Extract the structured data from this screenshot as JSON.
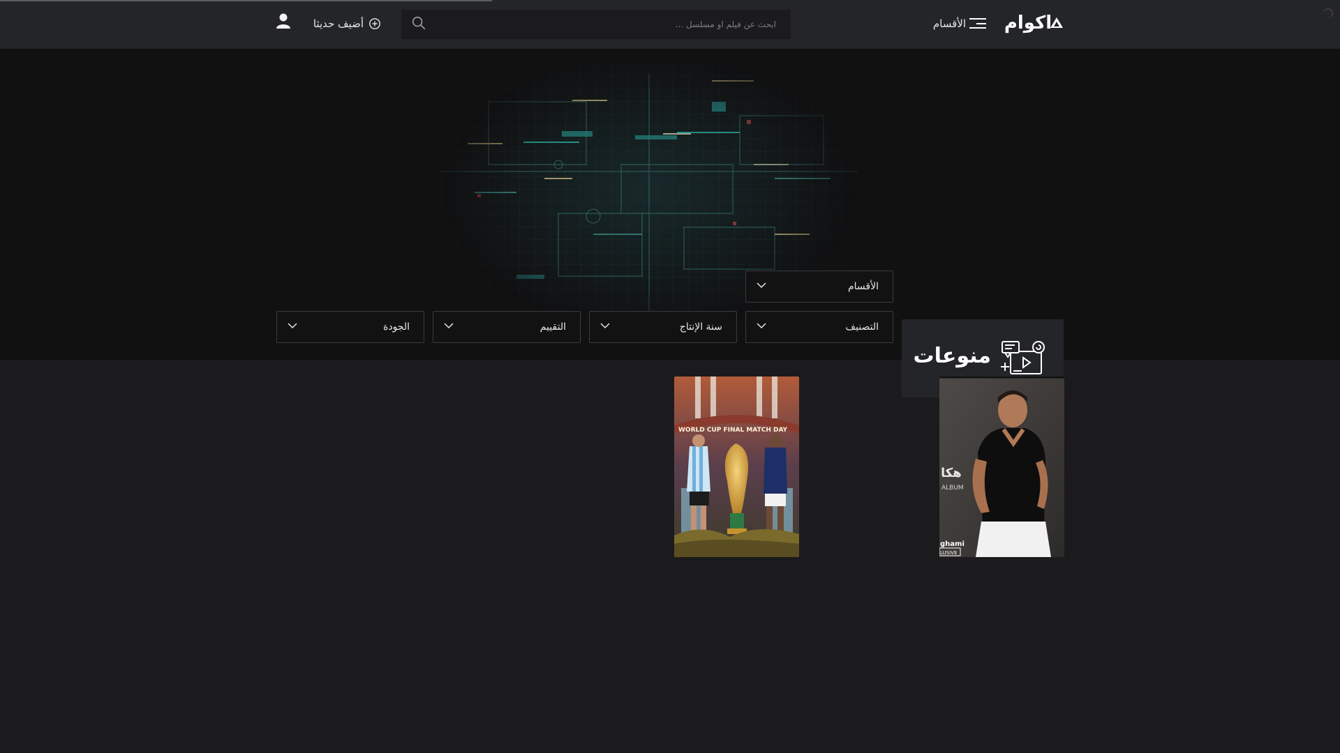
{
  "header": {
    "logo_text": "اكوام",
    "categories_label": "الأقسام",
    "search_placeholder": "ابحث عن فيلم او مسلسل ...",
    "add_recent_label": "أضيف حديثا"
  },
  "section": {
    "title": "منوعات",
    "icon": "tv-video-icon"
  },
  "filters": [
    {
      "label": "الأقسام"
    },
    {
      "label": "التصنيف"
    },
    {
      "label": "سنة الإنتاج"
    },
    {
      "label": "التقييم"
    },
    {
      "label": "الجودة"
    }
  ],
  "posters": [
    {
      "subject": "Amr Diab album cover",
      "text_left": "هكا",
      "badge": "ghami",
      "badge2": "LUSIVE",
      "album": "ALBUM"
    },
    {
      "subject": "World Cup final match day",
      "banner": "WORLD CUP FINAL MATCH DAY"
    }
  ],
  "colors": {
    "header_bg": "#242528",
    "page_bg": "#1b1b1d",
    "hero_bg": "#111112",
    "accent_teal": "#2bb3a8"
  }
}
